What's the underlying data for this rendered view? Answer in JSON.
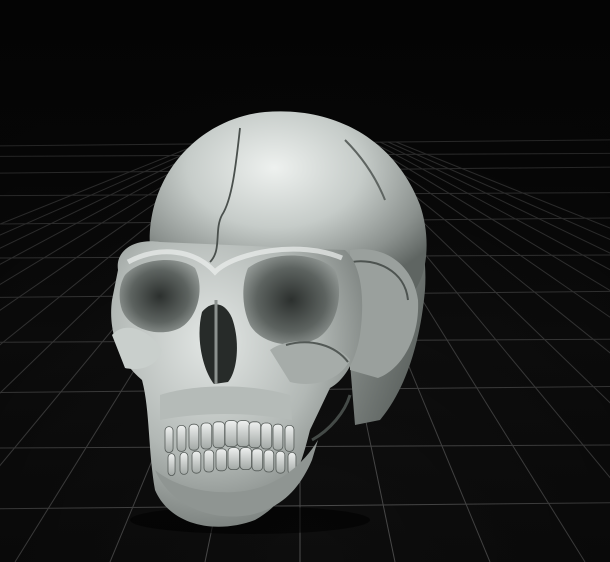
{
  "viewport": {
    "background_color": "#0b0b0b",
    "grid_line_color": "#5a5a5a",
    "model_base_color": "#b9bfbc",
    "model_shadow_color": "#6e7471",
    "model_highlight_color": "#eef1ef"
  },
  "model": {
    "name_icon": "skull-model"
  }
}
